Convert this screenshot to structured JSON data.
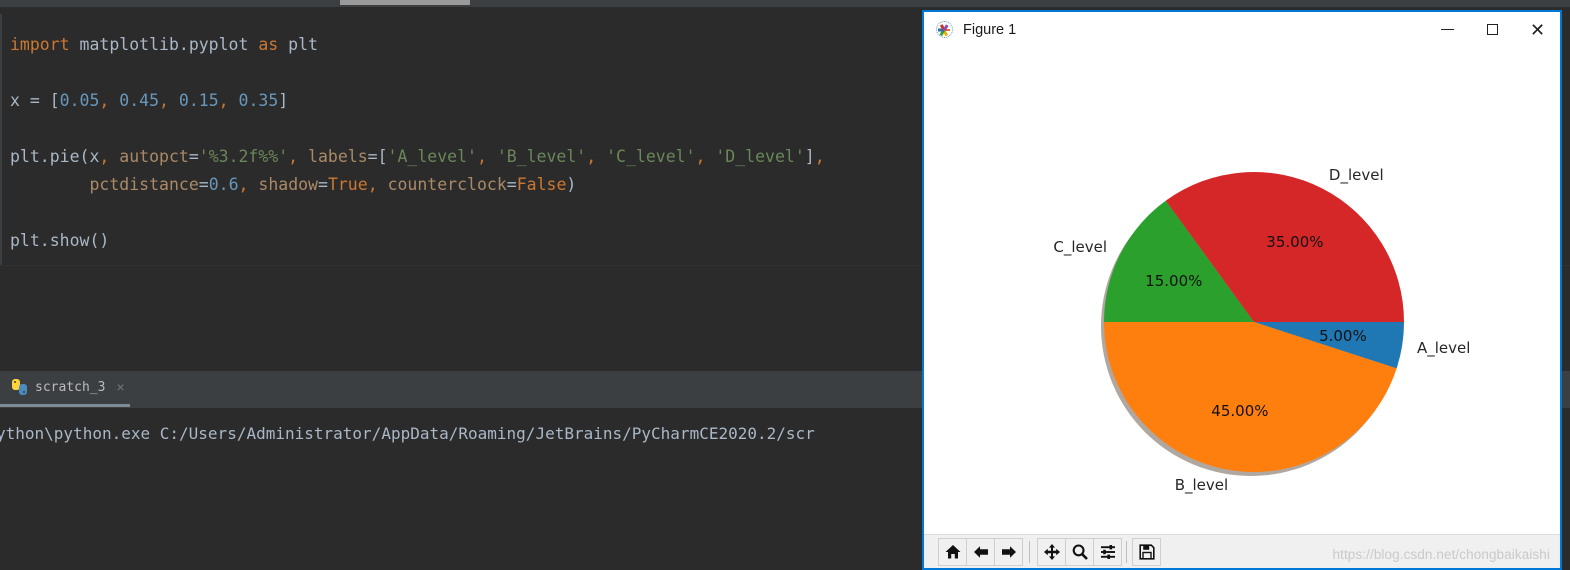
{
  "ide": {
    "editor": {
      "lines": [
        {
          "tokens": [
            {
              "t": "import",
              "c": "kw"
            },
            {
              "t": " matplotlib.pyplot ",
              "c": "plain"
            },
            {
              "t": "as",
              "c": "kw"
            },
            {
              "t": " plt",
              "c": "plain"
            }
          ]
        },
        {
          "tokens": []
        },
        {
          "tokens": [
            {
              "t": "x = [",
              "c": "plain"
            },
            {
              "t": "0.05",
              "c": "num"
            },
            {
              "t": ",",
              "c": "comma"
            },
            {
              "t": " ",
              "c": "plain"
            },
            {
              "t": "0.45",
              "c": "num"
            },
            {
              "t": ",",
              "c": "comma"
            },
            {
              "t": " ",
              "c": "plain"
            },
            {
              "t": "0.15",
              "c": "num"
            },
            {
              "t": ",",
              "c": "comma"
            },
            {
              "t": " ",
              "c": "plain"
            },
            {
              "t": "0.35",
              "c": "num"
            },
            {
              "t": "]",
              "c": "plain"
            }
          ]
        },
        {
          "tokens": []
        },
        {
          "tokens": [
            {
              "t": "plt.pie(x",
              "c": "plain"
            },
            {
              "t": ",",
              "c": "comma"
            },
            {
              "t": " ",
              "c": "plain"
            },
            {
              "t": "autopct",
              "c": "kwarg"
            },
            {
              "t": "=",
              "c": "plain"
            },
            {
              "t": "'%3.2f%%'",
              "c": "str"
            },
            {
              "t": ",",
              "c": "comma"
            },
            {
              "t": " ",
              "c": "plain"
            },
            {
              "t": "labels",
              "c": "kwarg"
            },
            {
              "t": "=[",
              "c": "plain"
            },
            {
              "t": "'A_level'",
              "c": "str"
            },
            {
              "t": ",",
              "c": "comma"
            },
            {
              "t": " ",
              "c": "plain"
            },
            {
              "t": "'B_level'",
              "c": "str"
            },
            {
              "t": ",",
              "c": "comma"
            },
            {
              "t": " ",
              "c": "plain"
            },
            {
              "t": "'C_level'",
              "c": "str"
            },
            {
              "t": ",",
              "c": "comma"
            },
            {
              "t": " ",
              "c": "plain"
            },
            {
              "t": "'D_level'",
              "c": "str"
            },
            {
              "t": "]",
              "c": "plain"
            },
            {
              "t": ",",
              "c": "comma"
            }
          ]
        },
        {
          "tokens": [
            {
              "t": "        ",
              "c": "plain"
            },
            {
              "t": "pctdistance",
              "c": "kwarg"
            },
            {
              "t": "=",
              "c": "plain"
            },
            {
              "t": "0.6",
              "c": "num"
            },
            {
              "t": ",",
              "c": "comma"
            },
            {
              "t": " ",
              "c": "plain"
            },
            {
              "t": "shadow",
              "c": "kwarg"
            },
            {
              "t": "=",
              "c": "plain"
            },
            {
              "t": "True",
              "c": "kw"
            },
            {
              "t": ",",
              "c": "comma"
            },
            {
              "t": " ",
              "c": "plain"
            },
            {
              "t": "counterclock",
              "c": "kwarg"
            },
            {
              "t": "=",
              "c": "plain"
            },
            {
              "t": "False",
              "c": "kw"
            },
            {
              "t": ")",
              "c": "plain"
            }
          ]
        },
        {
          "tokens": []
        },
        {
          "tokens": [
            {
              "t": "plt.show()",
              "c": "plain"
            }
          ]
        }
      ]
    },
    "run_panel": {
      "tab_label": "scratch_3",
      "tab_close": "×",
      "tab_icon": "python-icon",
      "console_line": "ython\\python.exe C:/Users/Administrator/AppData/Roaming/JetBrains/PyCharmCE2020.2/scr"
    }
  },
  "figure_window": {
    "title": "Figure 1",
    "icon": "matplotlib-icon",
    "controls": {
      "minimize": "–",
      "maximize": "□",
      "close": "✕"
    },
    "toolbar": {
      "buttons": [
        {
          "name": "home-icon",
          "tooltip": "Reset original view"
        },
        {
          "name": "back-arrow-icon",
          "tooltip": "Back to previous view"
        },
        {
          "name": "forward-arrow-icon",
          "tooltip": "Forward to next view"
        },
        {
          "name": "pan-move-icon",
          "tooltip": "Pan axes with left mouse, zoom with right"
        },
        {
          "name": "zoom-magnifier-icon",
          "tooltip": "Zoom to rectangle"
        },
        {
          "name": "configure-subplots-icon",
          "tooltip": "Configure subplots"
        },
        {
          "name": "save-floppy-icon",
          "tooltip": "Save the figure"
        }
      ]
    },
    "watermark": "https://blog.csdn.net/chongbaikaishi"
  },
  "chart_data": {
    "type": "pie",
    "title": "",
    "labels": [
      "A_level",
      "B_level",
      "C_level",
      "D_level"
    ],
    "values": [
      0.05,
      0.45,
      0.15,
      0.35
    ],
    "pct_labels": [
      "5.00%",
      "45.00%",
      "15.00%",
      "35.00%"
    ],
    "colors": [
      "#1f77b4",
      "#ff7f0e",
      "#2ca02c",
      "#d62728"
    ],
    "startangle": 0,
    "counterclock": false,
    "shadow": true,
    "pctdistance": 0.6,
    "labeldistance": 1.1,
    "autopct": "%3.2f%%",
    "shadow_color": "#b0a8a0",
    "legend": null,
    "grid": false
  }
}
